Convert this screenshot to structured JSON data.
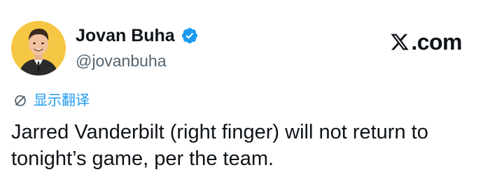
{
  "author": {
    "name": "Jovan Buha",
    "handle": "@jovanbuha",
    "verified": true,
    "avatar_icon": "avatar-portrait"
  },
  "brand": {
    "logo_icon": "x-logo-icon",
    "text": ".com"
  },
  "translate": {
    "icon": "translate-icon",
    "label": "显示翻译"
  },
  "tweet": {
    "text": "Jarred Vanderbilt (right finger) will not return to tonight’s game, per the team."
  },
  "colors": {
    "accent": "#1d9bf0",
    "text": "#0f1419",
    "secondary": "#536471",
    "avatar_bg": "#f6c744"
  }
}
